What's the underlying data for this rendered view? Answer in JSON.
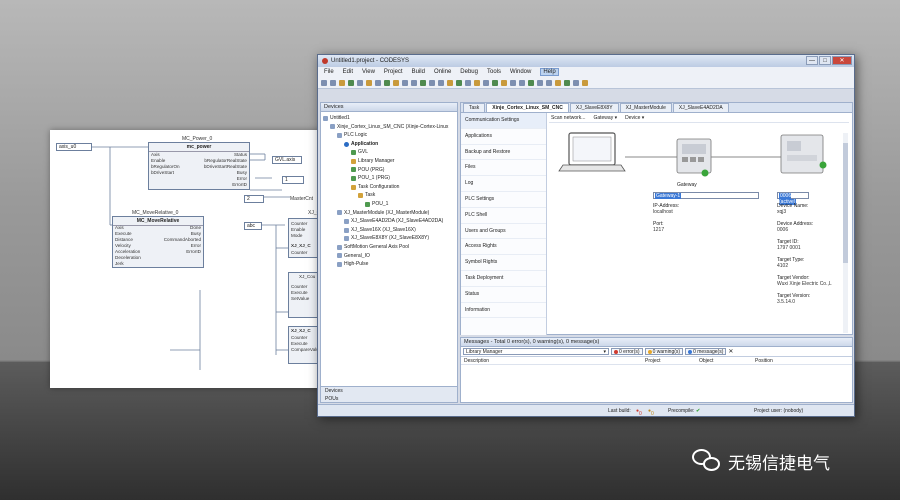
{
  "fbd": {
    "var_axis": "axis_u0",
    "power_instance": "MC_Power_0",
    "power_type": "mc_power",
    "power_inputs": [
      "Axis",
      "Enable",
      "bRegulatorOn",
      "bDriveStart"
    ],
    "power_outputs": [
      "Status",
      "bRegulatorRealState",
      "bDriveStartRealState",
      "Busy",
      "Error",
      "ErrorID"
    ],
    "rel_instance": "MC_MoveRelative_0",
    "rel_type": "MC_MoveRelative",
    "rel_inputs": [
      "Axis",
      "Execute",
      "Distance",
      "Velocity",
      "Acceleration",
      "Deceleration",
      "Jerk"
    ],
    "rel_outputs": [
      "Done",
      "Busy",
      "CommandAborted",
      "Error",
      "ErrorID"
    ],
    "var_gvl": "GVL.axis",
    "const_1": "1",
    "const_2": "2",
    "var_abc": "abc",
    "master_trunc": "MasterCnt",
    "xj_trunc": "XJ_Co",
    "blk_labels": [
      "XJ_XJ_C",
      "XJ_Cou",
      "XJ_XJ_C"
    ],
    "counter_pins": [
      "Counter",
      "Enable",
      "Mode"
    ],
    "counter_pins2": [
      "Counter",
      "Execute",
      "SetValue"
    ],
    "counter_pins3": [
      "Counter",
      "Execute",
      "CompareValu"
    ]
  },
  "window": {
    "title": "Untitled1.project - CODESYS",
    "controls": [
      "—",
      "□",
      "✕"
    ]
  },
  "menu": [
    "File",
    "Edit",
    "View",
    "Project",
    "Build",
    "Online",
    "Debug",
    "Tools",
    "Window",
    "Help"
  ],
  "devices": {
    "title": "Devices",
    "tree": [
      {
        "label": "Untitled1",
        "indent": 0,
        "icon": "project-icon",
        "bold": false
      },
      {
        "label": "Xinje_Cortex_Linux_SM_CNC (Xinje-Cortex-Linux",
        "indent": 1,
        "icon": "device-icon",
        "bold": false
      },
      {
        "label": "PLC Logic",
        "indent": 2,
        "icon": "plc-logic-icon",
        "bold": false
      },
      {
        "label": "Application",
        "indent": 3,
        "icon": "application-icon",
        "bold": true
      },
      {
        "label": "GVL",
        "indent": 4,
        "icon": "gvl-icon",
        "bold": false
      },
      {
        "label": "Library Manager",
        "indent": 4,
        "icon": "library-icon",
        "bold": false
      },
      {
        "label": "POU (PRG)",
        "indent": 4,
        "icon": "pou-icon",
        "bold": false
      },
      {
        "label": "POU_1 (PRG)",
        "indent": 4,
        "icon": "pou-icon",
        "bold": false
      },
      {
        "label": "Task Configuration",
        "indent": 4,
        "icon": "task-config-icon",
        "bold": false
      },
      {
        "label": "Task",
        "indent": 5,
        "icon": "task-icon",
        "bold": false
      },
      {
        "label": "POU_1",
        "indent": 6,
        "icon": "pou-icon",
        "bold": false
      },
      {
        "label": "XJ_MasterModule (XJ_MasterModule)",
        "indent": 2,
        "icon": "module-icon",
        "bold": false
      },
      {
        "label": "XJ_SlaveE4AD2DA (XJ_SlaveE4AD2DA)",
        "indent": 3,
        "icon": "slave-icon",
        "bold": false
      },
      {
        "label": "XJ_Slave16X (XJ_Slave16X)",
        "indent": 3,
        "icon": "slave-icon",
        "bold": false
      },
      {
        "label": "XJ_SlaveE8X8Y (XJ_SlaveE8X8Y)",
        "indent": 3,
        "icon": "slave-icon",
        "bold": false
      },
      {
        "label": "SoftMotion General Axis Pool",
        "indent": 2,
        "icon": "axis-pool-icon",
        "bold": false
      },
      {
        "label": "General_IO",
        "indent": 2,
        "icon": "io-icon",
        "bold": false
      },
      {
        "label": "High-Pulse",
        "indent": 2,
        "icon": "pulse-icon",
        "bold": false
      }
    ],
    "bottom_tabs": [
      "Devices",
      "POUs"
    ]
  },
  "editor": {
    "tabs": [
      "Task",
      "Xinje_Cortex_Linux_SM_CNC",
      "XJ_SlaveE8X8Y",
      "XJ_MasterModule",
      "XJ_SlaveE4AD2DA"
    ],
    "active_tab": "Xinje_Cortex_Linux_SM_CNC",
    "nav": [
      "Communication Settings",
      "Applications",
      "Backup and Restore",
      "Files",
      "Log",
      "PLC Settings",
      "PLC Shell",
      "Users and Groups",
      "Access Rights",
      "Symbol Rights",
      "Task Deployment",
      "Status",
      "Information"
    ],
    "scan": [
      "Scan network...",
      "Gateway ▾",
      "Device ▾"
    ],
    "gateway_label": "Gateway",
    "gateway_select": "Gateway-1",
    "device_select": "0006 (active)",
    "gateway_fields": [
      {
        "label": "IP-Address:",
        "value": "localhost"
      },
      {
        "label": "Port:",
        "value": "1217"
      }
    ],
    "device_fields": [
      {
        "label": "Device Name:",
        "value": "xqj3"
      },
      {
        "label": "Device Address:",
        "value": "0006"
      },
      {
        "label": "Target ID:",
        "value": "1797 0001"
      },
      {
        "label": "Target Type:",
        "value": "4102"
      },
      {
        "label": "Target Vendor:",
        "value": "Wuxi Xinje Electric Co.,L"
      },
      {
        "label": "Target Version:",
        "value": "3.5.14.0"
      }
    ]
  },
  "messages": {
    "title": "Messages - Total 0 error(s), 0 warning(s), 0 message(s)",
    "source": "Library Manager",
    "errors": "0 error(s)",
    "warnings": "0 warning(s)",
    "msgs": "0 message(s)",
    "columns": [
      "Description",
      "Project",
      "Object",
      "Position"
    ]
  },
  "status": {
    "last_build": "Last build:",
    "last_build_err": "0",
    "last_build_warn": "0",
    "precompile": "Precompile:",
    "project_user": "Project user: (nobody)"
  },
  "watermark": "无锡信捷电气",
  "colors": {
    "error": "#d03a2f",
    "warning": "#e6a72a",
    "message": "#3a78d6",
    "ok": "#3aa53a"
  }
}
